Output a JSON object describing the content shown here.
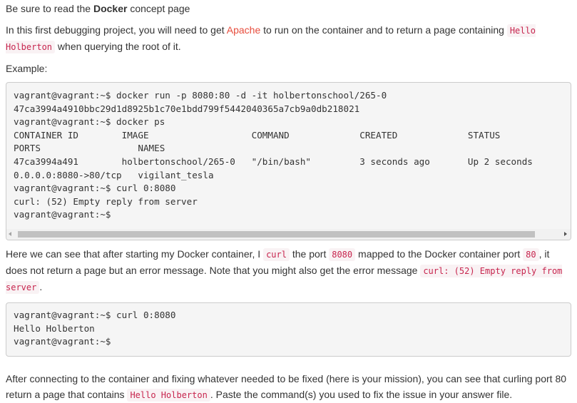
{
  "intro": {
    "prefix": "Be sure to read the ",
    "strong": "Docker",
    "suffix": " concept page"
  },
  "task": {
    "text1": "In this first debugging project, you will need to get ",
    "link": "Apache",
    "text2": " to run on the container and to return a page containing ",
    "code1": "Hello Holberton",
    "text3": " when querying the root of it."
  },
  "example_label": "Example:",
  "code_block_1": "vagrant@vagrant:~$ docker run -p 8080:80 -d -it holbertonschool/265-0\n47ca3994a4910bbc29d1d8925b1c70e1bdd799f5442040365a7cb9a0db218021\nvagrant@vagrant:~$ docker ps\nCONTAINER ID        IMAGE                   COMMAND             CREATED             STATUS              \nPORTS                  NAMES\n47ca3994a491        holbertonschool/265-0   \"/bin/bash\"         3 seconds ago       Up 2 seconds        \n0.0.0.0:8080->80/tcp   vigilant_tesla\nvagrant@vagrant:~$ curl 0:8080\ncurl: (52) Empty reply from server\nvagrant@vagrant:~$",
  "explanation": {
    "t1": "Here we can see that after starting my Docker container, I ",
    "c1": "curl",
    "t2": " the port ",
    "c2": "8080",
    "t3": " mapped to the Docker container port ",
    "c3": "80",
    "t4": ", it does not return a page but an error message. Note that you might also get the error message ",
    "c4": "curl: (52) Empty reply from server",
    "t5": "."
  },
  "code_block_2": "vagrant@vagrant:~$ curl 0:8080\nHello Holberton\nvagrant@vagrant:~$",
  "mission": {
    "t1": "After connecting to the container and fixing whatever needed to be fixed (here is your mission), you can see that curling port 80 return a page that contains ",
    "c1": "Hello Holberton",
    "t2": ". Paste the command(s) you used to fix the issue in your answer file."
  },
  "colors": {
    "link": "#e74c3c",
    "code_text": "#c7254e",
    "code_bg": "#f9f2f4",
    "pre_bg": "#f5f5f5"
  }
}
